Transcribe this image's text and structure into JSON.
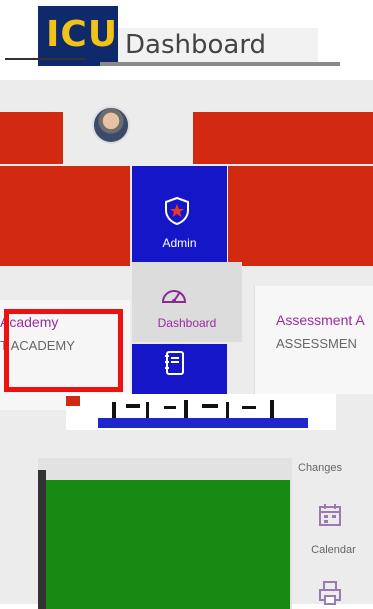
{
  "header": {
    "logo_text": "ICU",
    "title": "Dashboard"
  },
  "nav": {
    "admin_label": "Admin",
    "dashboard_label": "Dashboard",
    "calendar_label": "Calendar",
    "changes_label": "Changes"
  },
  "cards": {
    "academy": {
      "title": "Academy",
      "subtitle": "T ACADEMY"
    },
    "assessment": {
      "title": "Assessment A",
      "subtitle": "ASSESSMEN"
    }
  },
  "colors": {
    "tile_red": "#d12a10",
    "nav_blue": "#1616c9",
    "accent_purple": "#9c2aa0",
    "panel_green": "#178a14"
  },
  "icons": {
    "admin": "shield-star-icon",
    "dashboard": "speedometer-icon",
    "notebook": "notebook-icon",
    "calendar": "calendar-icon",
    "printer": "printer-icon"
  }
}
